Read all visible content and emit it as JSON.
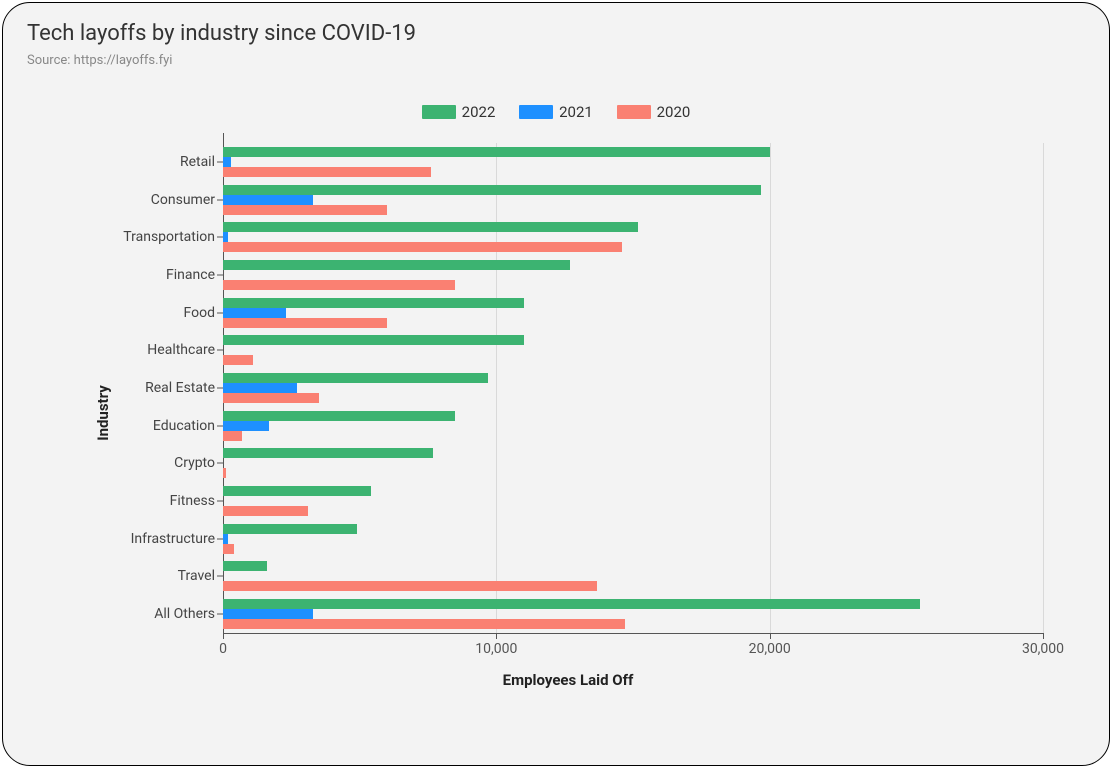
{
  "title": "Tech layoffs by industry since COVID-19",
  "subtitle": "Source: https://layoffs.fyi",
  "legend": {
    "s2022": "2022",
    "s2021": "2021",
    "s2020": "2020"
  },
  "axis": {
    "x_title": "Employees Laid Off",
    "y_title": "Industry",
    "x_ticks": {
      "t0": "0",
      "t10k": "10,000",
      "t20k": "20,000",
      "t30k": "30,000"
    }
  },
  "chart_data": {
    "type": "bar",
    "orientation": "horizontal",
    "title": "Tech layoffs by industry since COVID-19",
    "xlabel": "Employees Laid Off",
    "ylabel": "Industry",
    "xlim": [
      0,
      30000
    ],
    "categories": [
      "Retail",
      "Consumer",
      "Transportation",
      "Finance",
      "Food",
      "Healthcare",
      "Real Estate",
      "Education",
      "Crypto",
      "Fitness",
      "Infrastructure",
      "Travel",
      "All Others"
    ],
    "series": [
      {
        "name": "2022",
        "color": "#3cb371",
        "values": [
          20000,
          19700,
          15200,
          12700,
          11000,
          11000,
          9700,
          8500,
          7700,
          5400,
          4900,
          1600,
          25500
        ]
      },
      {
        "name": "2021",
        "color": "#1e90ff",
        "values": [
          300,
          3300,
          200,
          0,
          2300,
          0,
          2700,
          1700,
          0,
          0,
          200,
          0,
          3300
        ]
      },
      {
        "name": "2020",
        "color": "#fa8072",
        "values": [
          7600,
          6000,
          14600,
          8500,
          6000,
          1100,
          3500,
          700,
          100,
          3100,
          400,
          13700,
          14700
        ]
      }
    ],
    "legend_position": "top",
    "grid": {
      "x": true,
      "y": false
    }
  },
  "colors": {
    "s2022": "#3cb371",
    "s2021": "#1e90ff",
    "s2020": "#fa8072"
  }
}
